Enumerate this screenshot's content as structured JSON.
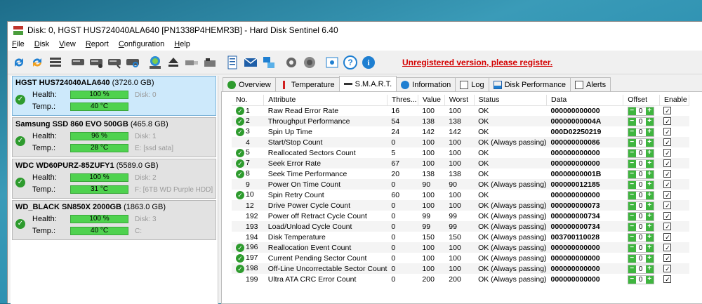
{
  "window": {
    "title": "Disk: 0, HGST HUS724040ALA640 [PN1338P4HEMR3B]  -  Hard Disk Sentinel 6.40"
  },
  "menu": [
    "File",
    "Disk",
    "View",
    "Report",
    "Configuration",
    "Help"
  ],
  "toolbar": {
    "icons": [
      "refresh-icon",
      "refresh-alert-icon",
      "disk-list-icon",
      "disk-test-icon",
      "disk-test2-icon",
      "disk-test3-icon",
      "disk-search-icon",
      "disk-info-icon",
      "eject-icon",
      "usb-icon",
      "drive-icon",
      "report-icon",
      "mail-icon",
      "network-icon",
      "settings-icon",
      "sound-icon",
      "camera-icon",
      "help-icon",
      "info-icon"
    ],
    "unregistered": "Unregistered version, please register."
  },
  "disks": [
    {
      "name": "HGST HUS724040ALA640",
      "size": "(3726.0 GB)",
      "health_label": "Health:",
      "health": "100 %",
      "temp_label": "Temp.:",
      "temp": "40 °C",
      "disk": "Disk: 0",
      "path": ""
    },
    {
      "name": "Samsung SSD 860 EVO 500GB",
      "size": "(465.8 GB)",
      "health_label": "Health:",
      "health": "96 %",
      "temp_label": "Temp.:",
      "temp": "28 °C",
      "disk": "Disk: 1",
      "path": "E: [ssd sata]"
    },
    {
      "name": "WDC WD60PURZ-85ZUFY1",
      "size": "(5589.0 GB)",
      "health_label": "Health:",
      "health": "100 %",
      "temp_label": "Temp.:",
      "temp": "31 °C",
      "disk": "Disk: 2",
      "path": "F: [6TB WD Purple HDD]"
    },
    {
      "name": "WD_BLACK SN850X 2000GB",
      "size": "(1863.0 GB)",
      "health_label": "Health:",
      "health": "100 %",
      "temp_label": "Temp.:",
      "temp": "40 °C",
      "disk": "Disk: 3",
      "path": "C:"
    }
  ],
  "tabs": [
    "Overview",
    "Temperature",
    "S.M.A.R.T.",
    "Information",
    "Log",
    "Disk Performance",
    "Alerts"
  ],
  "smart": {
    "headers": [
      "No.",
      "Attribute",
      "Thres...",
      "Value",
      "Worst",
      "Status",
      "Data",
      "Offset",
      "Enable"
    ],
    "rows": [
      {
        "check": true,
        "no": "1",
        "attr": "Raw Read Error Rate",
        "thres": "16",
        "value": "100",
        "worst": "100",
        "status": "OK",
        "data": "000000000000",
        "offset": "0"
      },
      {
        "check": true,
        "no": "2",
        "attr": "Throughput Performance",
        "thres": "54",
        "value": "138",
        "worst": "138",
        "status": "OK",
        "data": "00000000004A",
        "offset": "0"
      },
      {
        "check": true,
        "no": "3",
        "attr": "Spin Up Time",
        "thres": "24",
        "value": "142",
        "worst": "142",
        "status": "OK",
        "data": "000D02250219",
        "offset": "0"
      },
      {
        "check": false,
        "no": "4",
        "attr": "Start/Stop Count",
        "thres": "0",
        "value": "100",
        "worst": "100",
        "status": "OK (Always passing)",
        "data": "000000000086",
        "offset": "0"
      },
      {
        "check": true,
        "no": "5",
        "attr": "Reallocated Sectors Count",
        "thres": "5",
        "value": "100",
        "worst": "100",
        "status": "OK",
        "data": "000000000000",
        "offset": "0"
      },
      {
        "check": true,
        "no": "7",
        "attr": "Seek Error Rate",
        "thres": "67",
        "value": "100",
        "worst": "100",
        "status": "OK",
        "data": "000000000000",
        "offset": "0"
      },
      {
        "check": true,
        "no": "8",
        "attr": "Seek Time Performance",
        "thres": "20",
        "value": "138",
        "worst": "138",
        "status": "OK",
        "data": "00000000001B",
        "offset": "0"
      },
      {
        "check": false,
        "no": "9",
        "attr": "Power On Time Count",
        "thres": "0",
        "value": "90",
        "worst": "90",
        "status": "OK (Always passing)",
        "data": "000000012185",
        "offset": "0"
      },
      {
        "check": true,
        "no": "10",
        "attr": "Spin Retry Count",
        "thres": "60",
        "value": "100",
        "worst": "100",
        "status": "OK",
        "data": "000000000000",
        "offset": "0"
      },
      {
        "check": false,
        "no": "12",
        "attr": "Drive Power Cycle Count",
        "thres": "0",
        "value": "100",
        "worst": "100",
        "status": "OK (Always passing)",
        "data": "000000000073",
        "offset": "0"
      },
      {
        "check": false,
        "no": "192",
        "attr": "Power off Retract Cycle Count",
        "thres": "0",
        "value": "99",
        "worst": "99",
        "status": "OK (Always passing)",
        "data": "000000000734",
        "offset": "0"
      },
      {
        "check": false,
        "no": "193",
        "attr": "Load/Unload Cycle Count",
        "thres": "0",
        "value": "99",
        "worst": "99",
        "status": "OK (Always passing)",
        "data": "000000000734",
        "offset": "0"
      },
      {
        "check": false,
        "no": "194",
        "attr": "Disk Temperature",
        "thres": "0",
        "value": "150",
        "worst": "150",
        "status": "OK (Always passing)",
        "data": "003700110028",
        "offset": "0"
      },
      {
        "check": true,
        "no": "196",
        "attr": "Reallocation Event Count",
        "thres": "0",
        "value": "100",
        "worst": "100",
        "status": "OK (Always passing)",
        "data": "000000000000",
        "offset": "0"
      },
      {
        "check": true,
        "no": "197",
        "attr": "Current Pending Sector Count",
        "thres": "0",
        "value": "100",
        "worst": "100",
        "status": "OK (Always passing)",
        "data": "000000000000",
        "offset": "0"
      },
      {
        "check": true,
        "no": "198",
        "attr": "Off-Line Uncorrectable Sector Count",
        "thres": "0",
        "value": "100",
        "worst": "100",
        "status": "OK (Always passing)",
        "data": "000000000000",
        "offset": "0"
      },
      {
        "check": false,
        "no": "199",
        "attr": "Ultra ATA CRC Error Count",
        "thres": "0",
        "value": "200",
        "worst": "200",
        "status": "OK (Always passing)",
        "data": "000000000000",
        "offset": "0"
      }
    ]
  }
}
